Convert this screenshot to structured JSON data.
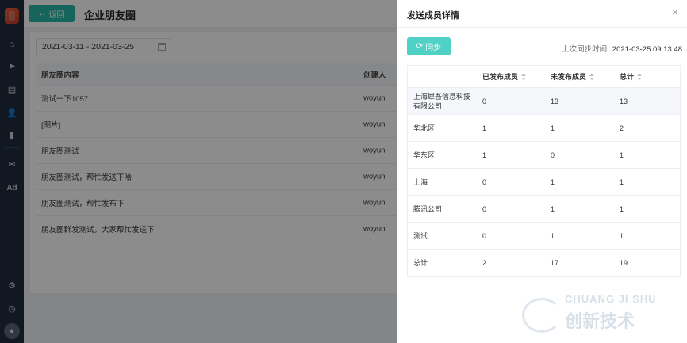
{
  "rail": {
    "icons": [
      "home-icon",
      "send-icon",
      "panel-icon",
      "user-icon",
      "bar-chart-icon",
      "wechat-icon"
    ],
    "ad_label": "Ad",
    "bottom_icons": [
      "gear-icon",
      "clock-icon"
    ]
  },
  "header": {
    "back_label": "返回",
    "title": "企业朋友圈"
  },
  "filter": {
    "date_range": "2021-03-11 - 2021-03-25"
  },
  "main_table": {
    "columns": [
      "朋友圈内容",
      "创建人"
    ],
    "rows": [
      {
        "content": "测试一下1057",
        "creator": "woyun"
      },
      {
        "content": "[图片]",
        "creator": "woyun"
      },
      {
        "content": "朋友圈测试",
        "creator": "woyun"
      },
      {
        "content": "朋友圈测试，帮忙发送下哈",
        "creator": "woyun"
      },
      {
        "content": "朋友圈测试，帮忙发布下",
        "creator": "woyun"
      },
      {
        "content": "朋友圈群发测试，大家帮忙发送下",
        "creator": "woyun"
      }
    ]
  },
  "drawer": {
    "title": "发送成员详情",
    "sync_label": "同步",
    "last_sync_label": "上次同步时间:",
    "last_sync_value": "2021-03-25 09:13:48",
    "columns": [
      "",
      "已发布成员",
      "未发布成员",
      "总计"
    ],
    "rows": [
      {
        "name": "上海犀吾信息科技有限公司",
        "published": "0",
        "unpublished": "13",
        "total": "13"
      },
      {
        "name": "华北区",
        "published": "1",
        "unpublished": "1",
        "total": "2"
      },
      {
        "name": "华东区",
        "published": "1",
        "unpublished": "0",
        "total": "1"
      },
      {
        "name": "上海",
        "published": "0",
        "unpublished": "1",
        "total": "1"
      },
      {
        "name": "腾讯公司",
        "published": "0",
        "unpublished": "1",
        "total": "1"
      },
      {
        "name": "测试",
        "published": "0",
        "unpublished": "1",
        "total": "1"
      },
      {
        "name": "总计",
        "published": "2",
        "unpublished": "17",
        "total": "19"
      }
    ]
  },
  "watermark": {
    "en": "CHUANG JI SHU",
    "cn": "创新技术"
  },
  "colors": {
    "accent": "#29b9a8",
    "sync": "#4fd1c5",
    "rail": "#1f2d3d"
  }
}
